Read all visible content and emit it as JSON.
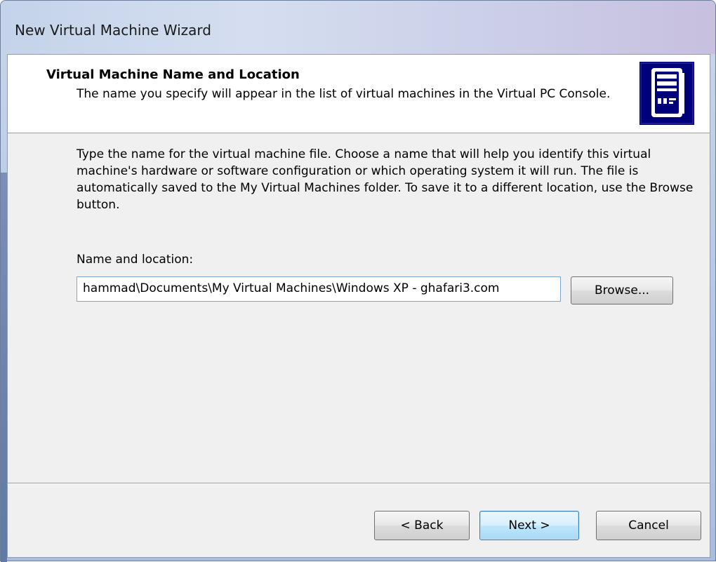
{
  "window": {
    "title": "New Virtual Machine Wizard"
  },
  "header": {
    "title": "Virtual Machine Name and Location",
    "subtitle": "The name you specify will appear in the list of virtual machines in the Virtual PC Console.",
    "icon": "computer-tower-icon"
  },
  "body": {
    "description": "Type the name for the virtual machine file. Choose a name that will help you identify this virtual machine's hardware or software configuration or which operating system it will run. The file is automatically saved to the My Virtual Machines folder. To save it to a different location, use the Browse button.",
    "name_label": "Name and location:",
    "name_value": "hammad\\Documents\\My Virtual Machines\\Windows XP - ghafari3.com",
    "browse_label": "Browse..."
  },
  "footer": {
    "back_label": "< Back",
    "next_label": "Next >",
    "cancel_label": "Cancel"
  },
  "colors": {
    "accent": "#3c7fb1",
    "icon_bg": "#00007a"
  }
}
